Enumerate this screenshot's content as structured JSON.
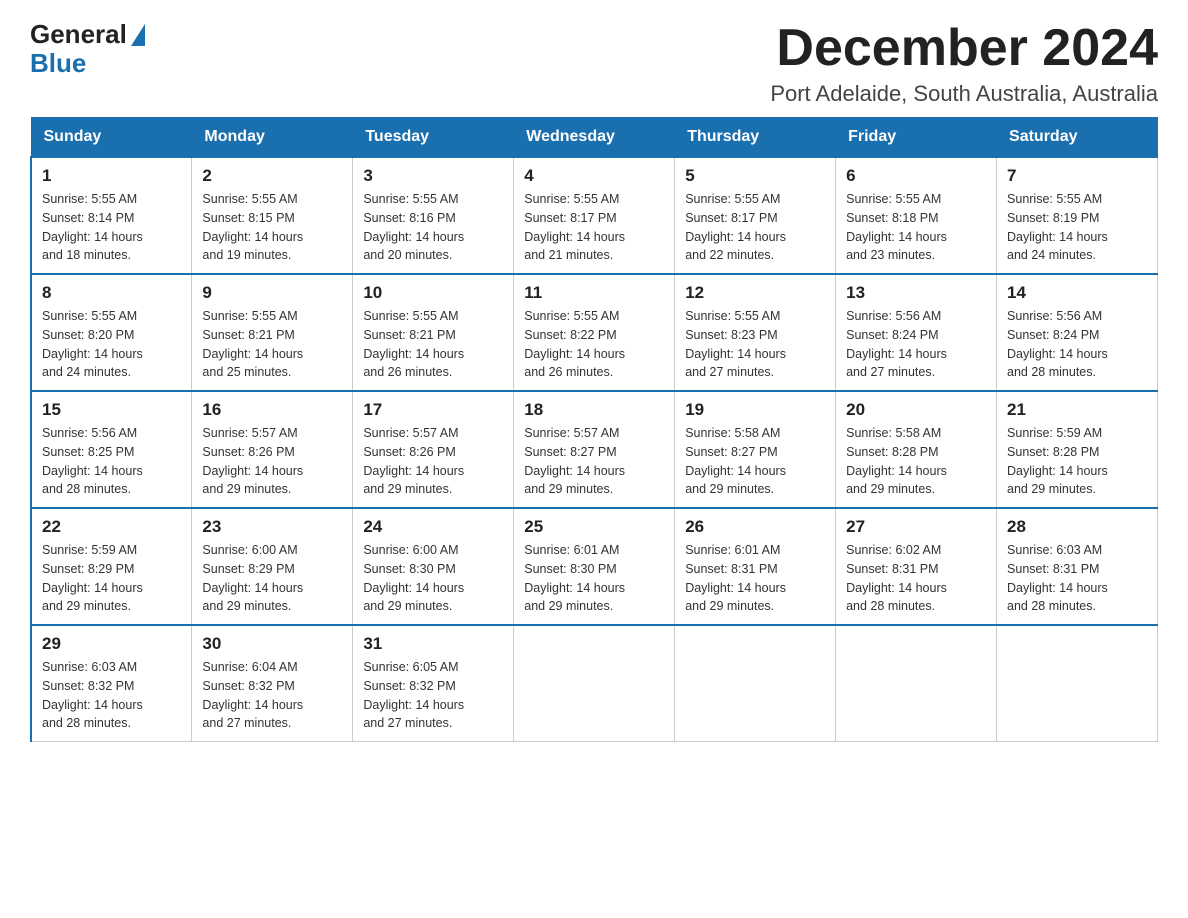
{
  "header": {
    "logo": {
      "general": "General",
      "blue": "Blue"
    },
    "title": "December 2024",
    "subtitle": "Port Adelaide, South Australia, Australia"
  },
  "days_of_week": [
    "Sunday",
    "Monday",
    "Tuesday",
    "Wednesday",
    "Thursday",
    "Friday",
    "Saturday"
  ],
  "weeks": [
    [
      {
        "day": "1",
        "sunrise": "5:55 AM",
        "sunset": "8:14 PM",
        "daylight": "14 hours and 18 minutes."
      },
      {
        "day": "2",
        "sunrise": "5:55 AM",
        "sunset": "8:15 PM",
        "daylight": "14 hours and 19 minutes."
      },
      {
        "day": "3",
        "sunrise": "5:55 AM",
        "sunset": "8:16 PM",
        "daylight": "14 hours and 20 minutes."
      },
      {
        "day": "4",
        "sunrise": "5:55 AM",
        "sunset": "8:17 PM",
        "daylight": "14 hours and 21 minutes."
      },
      {
        "day": "5",
        "sunrise": "5:55 AM",
        "sunset": "8:17 PM",
        "daylight": "14 hours and 22 minutes."
      },
      {
        "day": "6",
        "sunrise": "5:55 AM",
        "sunset": "8:18 PM",
        "daylight": "14 hours and 23 minutes."
      },
      {
        "day": "7",
        "sunrise": "5:55 AM",
        "sunset": "8:19 PM",
        "daylight": "14 hours and 24 minutes."
      }
    ],
    [
      {
        "day": "8",
        "sunrise": "5:55 AM",
        "sunset": "8:20 PM",
        "daylight": "14 hours and 24 minutes."
      },
      {
        "day": "9",
        "sunrise": "5:55 AM",
        "sunset": "8:21 PM",
        "daylight": "14 hours and 25 minutes."
      },
      {
        "day": "10",
        "sunrise": "5:55 AM",
        "sunset": "8:21 PM",
        "daylight": "14 hours and 26 minutes."
      },
      {
        "day": "11",
        "sunrise": "5:55 AM",
        "sunset": "8:22 PM",
        "daylight": "14 hours and 26 minutes."
      },
      {
        "day": "12",
        "sunrise": "5:55 AM",
        "sunset": "8:23 PM",
        "daylight": "14 hours and 27 minutes."
      },
      {
        "day": "13",
        "sunrise": "5:56 AM",
        "sunset": "8:24 PM",
        "daylight": "14 hours and 27 minutes."
      },
      {
        "day": "14",
        "sunrise": "5:56 AM",
        "sunset": "8:24 PM",
        "daylight": "14 hours and 28 minutes."
      }
    ],
    [
      {
        "day": "15",
        "sunrise": "5:56 AM",
        "sunset": "8:25 PM",
        "daylight": "14 hours and 28 minutes."
      },
      {
        "day": "16",
        "sunrise": "5:57 AM",
        "sunset": "8:26 PM",
        "daylight": "14 hours and 29 minutes."
      },
      {
        "day": "17",
        "sunrise": "5:57 AM",
        "sunset": "8:26 PM",
        "daylight": "14 hours and 29 minutes."
      },
      {
        "day": "18",
        "sunrise": "5:57 AM",
        "sunset": "8:27 PM",
        "daylight": "14 hours and 29 minutes."
      },
      {
        "day": "19",
        "sunrise": "5:58 AM",
        "sunset": "8:27 PM",
        "daylight": "14 hours and 29 minutes."
      },
      {
        "day": "20",
        "sunrise": "5:58 AM",
        "sunset": "8:28 PM",
        "daylight": "14 hours and 29 minutes."
      },
      {
        "day": "21",
        "sunrise": "5:59 AM",
        "sunset": "8:28 PM",
        "daylight": "14 hours and 29 minutes."
      }
    ],
    [
      {
        "day": "22",
        "sunrise": "5:59 AM",
        "sunset": "8:29 PM",
        "daylight": "14 hours and 29 minutes."
      },
      {
        "day": "23",
        "sunrise": "6:00 AM",
        "sunset": "8:29 PM",
        "daylight": "14 hours and 29 minutes."
      },
      {
        "day": "24",
        "sunrise": "6:00 AM",
        "sunset": "8:30 PM",
        "daylight": "14 hours and 29 minutes."
      },
      {
        "day": "25",
        "sunrise": "6:01 AM",
        "sunset": "8:30 PM",
        "daylight": "14 hours and 29 minutes."
      },
      {
        "day": "26",
        "sunrise": "6:01 AM",
        "sunset": "8:31 PM",
        "daylight": "14 hours and 29 minutes."
      },
      {
        "day": "27",
        "sunrise": "6:02 AM",
        "sunset": "8:31 PM",
        "daylight": "14 hours and 28 minutes."
      },
      {
        "day": "28",
        "sunrise": "6:03 AM",
        "sunset": "8:31 PM",
        "daylight": "14 hours and 28 minutes."
      }
    ],
    [
      {
        "day": "29",
        "sunrise": "6:03 AM",
        "sunset": "8:32 PM",
        "daylight": "14 hours and 28 minutes."
      },
      {
        "day": "30",
        "sunrise": "6:04 AM",
        "sunset": "8:32 PM",
        "daylight": "14 hours and 27 minutes."
      },
      {
        "day": "31",
        "sunrise": "6:05 AM",
        "sunset": "8:32 PM",
        "daylight": "14 hours and 27 minutes."
      },
      null,
      null,
      null,
      null
    ]
  ],
  "labels": {
    "sunrise": "Sunrise:",
    "sunset": "Sunset:",
    "daylight": "Daylight:"
  }
}
